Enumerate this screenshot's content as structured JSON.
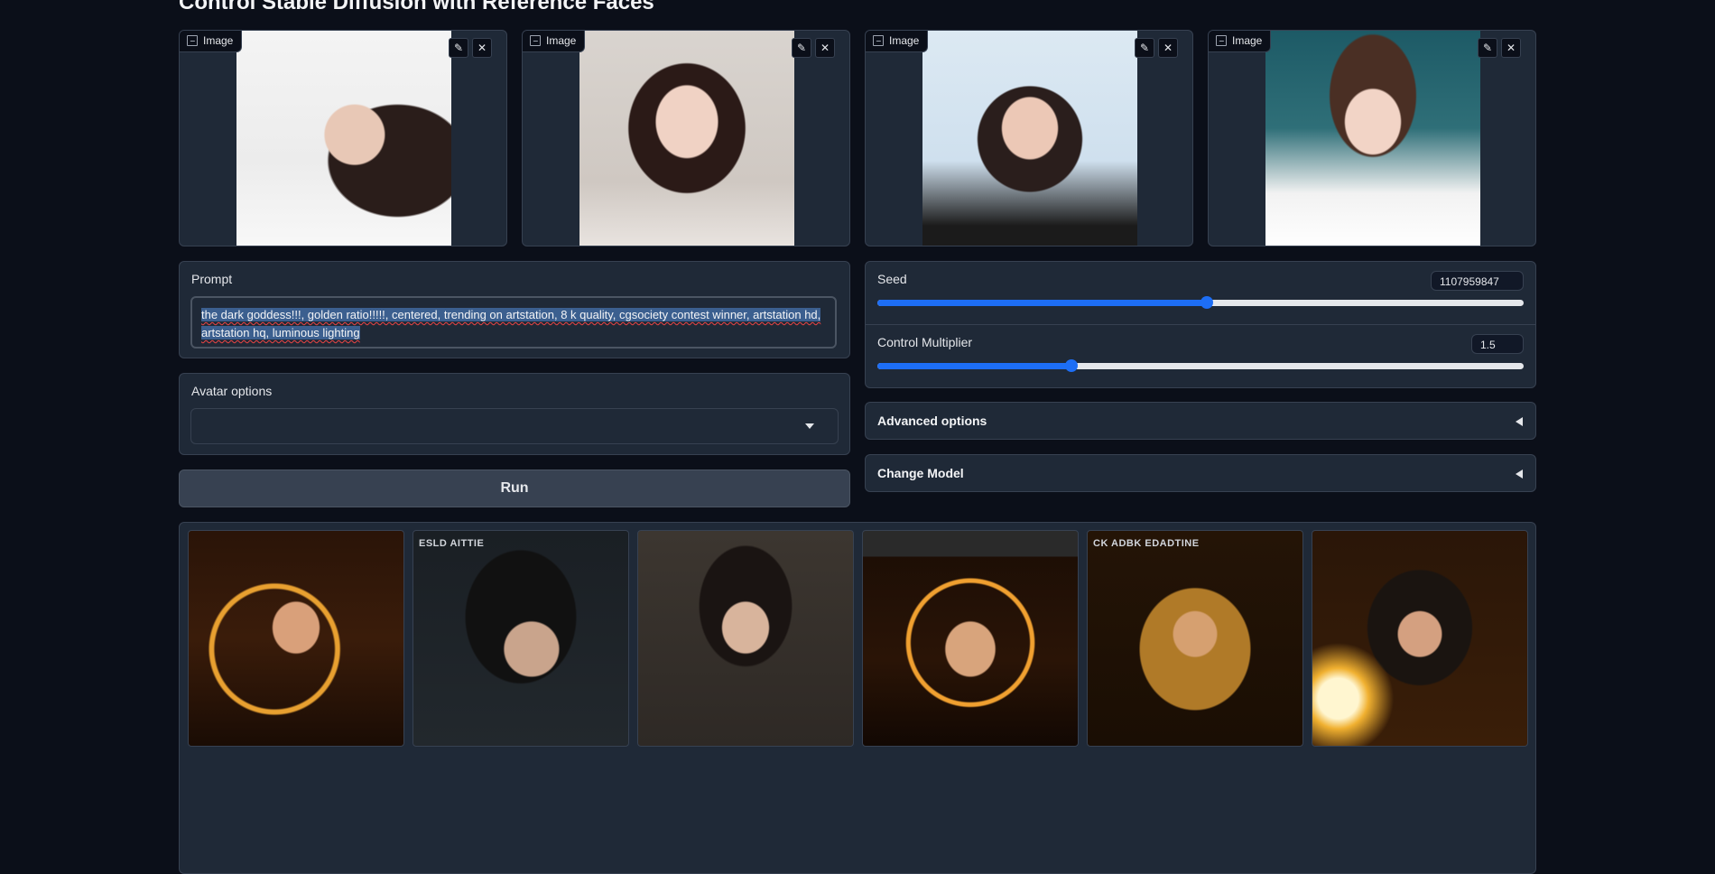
{
  "page": {
    "title": "Control Stable Diffusion with Reference Faces"
  },
  "reference_images": [
    {
      "label": "Image"
    },
    {
      "label": "Image"
    },
    {
      "label": "Image"
    },
    {
      "label": "Image"
    }
  ],
  "prompt": {
    "label": "Prompt",
    "value": "the dark goddess!!!, golden ratio!!!!!, centered, trending on artstation, 8 k quality, cgsociety contest winner, artstation hd, artstation hq, luminous lighting"
  },
  "avatar_options": {
    "label": "Avatar options",
    "value": ""
  },
  "run_button": {
    "label": "Run"
  },
  "seed": {
    "label": "Seed",
    "value": "1107959847",
    "fraction": 0.51
  },
  "control_multiplier": {
    "label": "Control Multiplier",
    "value": "1.5",
    "fraction": 0.3
  },
  "advanced_options": {
    "label": "Advanced options"
  },
  "change_model": {
    "label": "Change Model"
  },
  "gallery": {
    "captions": [
      "",
      "ESLD AITTIE",
      "",
      "",
      "CK ADBK EDADTINE",
      ""
    ]
  },
  "colors": {
    "background": "#0b0f19",
    "panel": "#1f2937",
    "accent": "#1d6ef5"
  }
}
